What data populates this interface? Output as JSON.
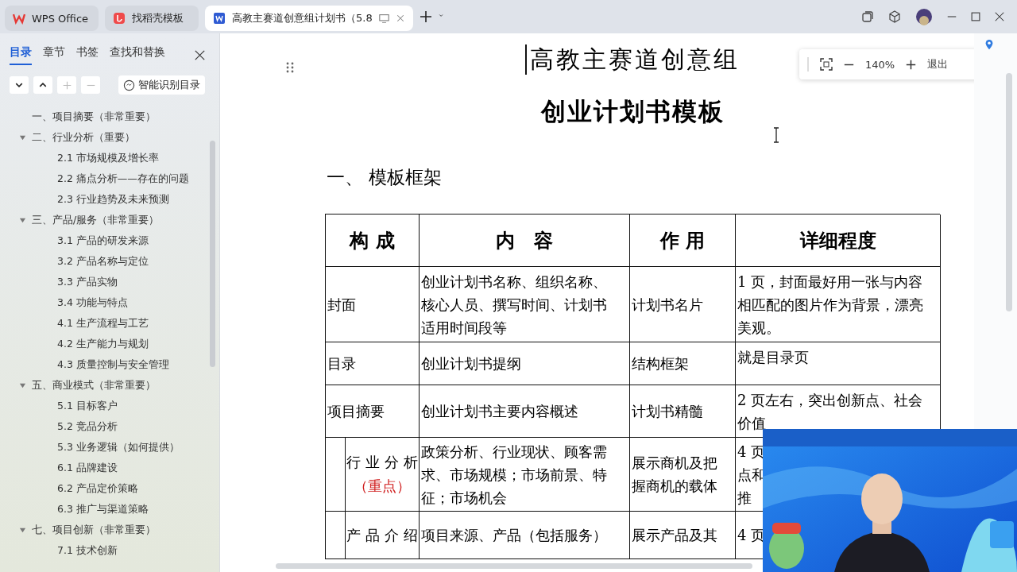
{
  "tabs": [
    {
      "kind": "home",
      "label": "WPS Office",
      "selected": false
    },
    {
      "kind": "template",
      "label": "找稻壳模板",
      "selected": false
    },
    {
      "kind": "doc",
      "label": "高教主赛道创意组计划书（5.8",
      "selected": true
    }
  ],
  "zoom": {
    "value": "140%",
    "exit": "退出"
  },
  "sidebar": {
    "tabs": [
      {
        "label": "目录",
        "selected": true
      },
      {
        "label": "章节",
        "selected": false
      },
      {
        "label": "书签",
        "selected": false
      },
      {
        "label": "查找和替换",
        "selected": false
      }
    ],
    "smart_button": "智能识别目录",
    "outline": [
      {
        "label": "一、项目摘要（非常重要）"
      },
      {
        "label": "二、行业分析（重要）",
        "expanded": true,
        "children": [
          {
            "label": "2.1 市场规模及增长率"
          },
          {
            "label": "2.2 痛点分析——存在的问题"
          },
          {
            "label": "2.3 行业趋势及未来预测"
          }
        ]
      },
      {
        "label": "三、产品/服务（非常重要）",
        "expanded": true,
        "children": [
          {
            "label": "3.1 产品的研发来源"
          },
          {
            "label": "3.2  产品名称与定位"
          },
          {
            "label": "3.3  产品实物"
          },
          {
            "label": "3.4  功能与特点"
          },
          {
            "label": "4.1 生产流程与工艺"
          },
          {
            "label": "4.2 生产能力与规划"
          },
          {
            "label": "4.3 质量控制与安全管理"
          }
        ]
      },
      {
        "label": "五、商业模式（非常重要）",
        "expanded": true,
        "children": [
          {
            "label": "5.1 目标客户"
          },
          {
            "label": "5.2 竞品分析"
          },
          {
            "label": "5.3 业务逻辑（如何提供）"
          },
          {
            "label": "6.1 品牌建设"
          },
          {
            "label": "6.2 产品定价策略"
          },
          {
            "label": "6.3 推广与渠道策略"
          }
        ]
      },
      {
        "label": "七、项目创新（非常重要）",
        "expanded": true,
        "children": [
          {
            "label": "7.1  技术创新"
          }
        ]
      }
    ]
  },
  "document": {
    "title": "高教主赛道创意组",
    "subtitle": "创业计划书模板",
    "heading": "一、  模板框架",
    "table": {
      "columns": [
        "构 成",
        "内　容",
        "作 用",
        "详细程度"
      ],
      "rows": [
        {
          "kind": "main",
          "cells": [
            [
              "封面"
            ],
            [
              "创业计划书名称、组织名称、",
              "核心人员、撰写时间、计划书",
              "适用时间段等"
            ],
            [
              "计划书名片"
            ],
            [
              "1 页，封面最好用一张与内容",
              "相匹配的图片作为背景，漂亮",
              "美观。"
            ]
          ]
        },
        {
          "kind": "main",
          "cells": [
            [
              "目录"
            ],
            [
              "创业计划书提纲"
            ],
            [
              "结构框架"
            ],
            [
              "就是目录页"
            ]
          ]
        },
        {
          "kind": "main",
          "cells": [
            [
              "项目摘要"
            ],
            [
              "创业计划书主要内容概述"
            ],
            [
              "计划书精髓"
            ],
            [
              "2 页左右，突出创新点、社会",
              "价值"
            ]
          ]
        },
        {
          "kind": "sub",
          "note": "（重点）",
          "cells": [
            [
              "行 业 分 析"
            ],
            [
              "政策分析、行业现状、顾客需",
              "求、市场规模；市场前景、特",
              "征；市场机会"
            ],
            [
              "展示商机及把",
              "握商机的载体"
            ],
            [
              "4 页",
              "点和",
              "推"
            ]
          ]
        },
        {
          "kind": "sub",
          "cells": [
            [
              "产 品 介 绍"
            ],
            [
              "项目来源、产品（包括服务）"
            ],
            [
              "展示产品及其"
            ],
            [
              "4 页"
            ]
          ]
        }
      ]
    }
  }
}
